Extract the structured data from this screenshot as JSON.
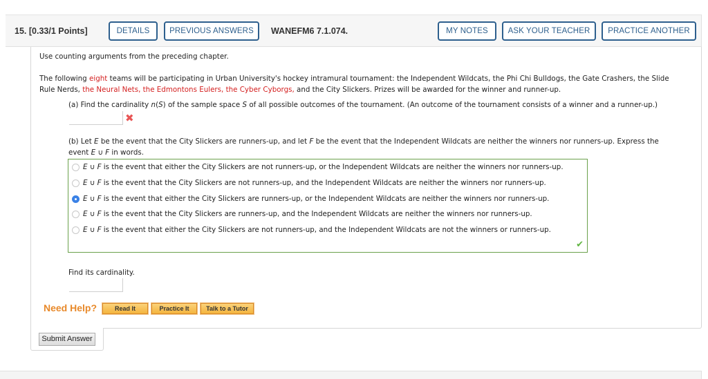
{
  "header": {
    "question_number": "15.",
    "points": "[0.33/1 Points]",
    "details_label": "DETAILS",
    "previous_answers_label": "PREVIOUS ANSWERS",
    "question_code": "WANEFM6 7.1.074.",
    "my_notes_label": "MY NOTES",
    "ask_teacher_label": "ASK YOUR TEACHER",
    "practice_another_label": "PRACTICE ANOTHER",
    "accent_color": "#2d5f8d"
  },
  "question": {
    "instruction": "Use counting arguments from the preceding chapter.",
    "intro_1a": "The following ",
    "intro_1_red": "eight",
    "intro_1b": " teams will be participating in Urban University's hockey intramural tournament: the Independent Wildcats, the Phi Chi Bulldogs, the Gate Crashers, the Slide",
    "intro_2a": "Rule Nerds, ",
    "intro_2_red": "the Neural Nets, the Edmontons Eulers, the Cyber Cyborgs,",
    "intro_2b": " and the City Slickers. Prizes will be awarded for the winner and runner-up.",
    "part_a": {
      "text_1": "(a) Find the cardinality ",
      "n_var": "n",
      "text_2": "(",
      "s_var": "S",
      "text_3": ") of the sample space ",
      "s_var2": "S",
      "text_4": " of all possible outcomes of the tournament. (An outcome of the tournament consists of a winner and a runner-up.)",
      "answer_value": "",
      "status": "incorrect",
      "status_icon": "x-mark-icon"
    },
    "part_b": {
      "line1_a": "(b) Let ",
      "e_var": "E",
      "line1_b": " be the event that the City Slickers are runners-up, and let ",
      "f_var": "F",
      "line1_c": " be the event that the Independent Wildcats are neither the winners nor runners-up. Express the",
      "line2_a": "event ",
      "line2_expr": "E ∪ F",
      "line2_b": " in words.",
      "choices": [
        {
          "expr": "E ∪ F",
          "text": " is the event that either the City Slickers are not runners-up, or the Independent Wildcats are neither the winners nor runners-up.",
          "selected": false
        },
        {
          "expr": "E ∪ F",
          "text": " is the event that the City Slickers are not runners-up, and the Independent Wildcats are neither the winners nor runners-up.",
          "selected": false
        },
        {
          "expr": "E ∪ F",
          "text": " is the event that either the City Slickers are runners-up, or the Independent Wildcats are neither the winners nor runners-up.",
          "selected": true
        },
        {
          "expr": "E ∪ F",
          "text": " is the event that the City Slickers are runners-up, and the Independent Wildcats are neither the winners nor runners-up.",
          "selected": false
        },
        {
          "expr": "E ∪ F",
          "text": " is the event that either the City Slickers are not runners-up, and the Independent Wildcats are not the winners or runners-up.",
          "selected": false
        }
      ],
      "status": "correct",
      "status_icon": "check-mark-icon",
      "find_cardinality_label": "Find its cardinality.",
      "cardinality_value": ""
    }
  },
  "help": {
    "need_help_label": "Need Help?",
    "read_it_label": "Read It",
    "practice_it_label": "Practice It",
    "talk_tutor_label": "Talk to a Tutor"
  },
  "submit_label": "Submit Answer"
}
